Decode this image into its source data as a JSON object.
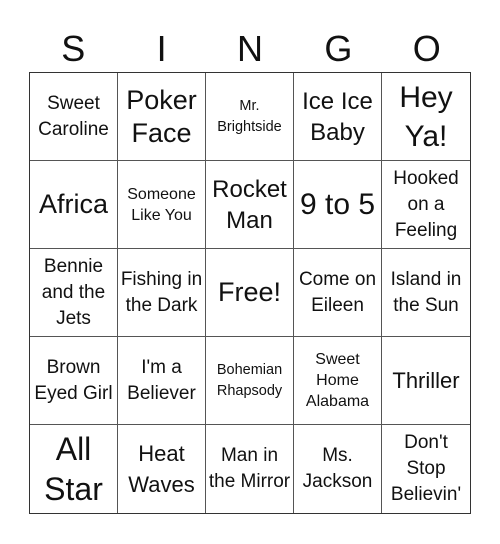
{
  "header": {
    "letters": [
      "S",
      "I",
      "N",
      "G",
      "O"
    ]
  },
  "board": {
    "cells": [
      "Sweet Caroline",
      "Poker Face",
      "Mr. Brightside",
      "Ice Ice Baby",
      "Hey Ya!",
      "Africa",
      "Someone Like You",
      "Rocket Man",
      "9 to 5",
      "Hooked on a Feeling",
      "Bennie and the Jets",
      "Fishing in the Dark",
      "Free!",
      "Come on Eileen",
      "Island in the Sun",
      "Brown Eyed Girl",
      "I'm a Believer",
      "Bohemian Rhapsody",
      "Sweet Home Alabama",
      "Thriller",
      "All Star",
      "Heat Waves",
      "Man in the Mirror",
      "Ms. Jackson",
      "Don't Stop Believin'"
    ],
    "free_space": "Free!"
  }
}
